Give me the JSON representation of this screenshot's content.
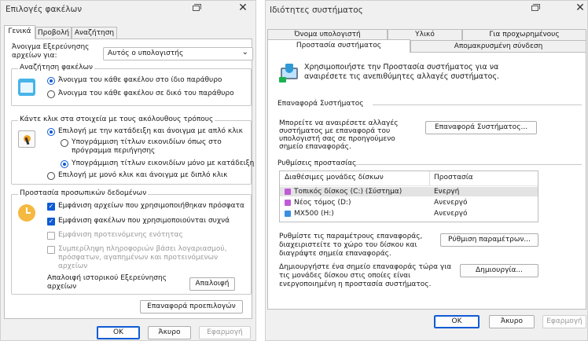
{
  "left": {
    "title": "Επιλογές φακέλων",
    "tabs": [
      "Γενικά",
      "Προβολή",
      "Αναζήτηση"
    ],
    "open_label_line1": "Άνοιγμα Εξερεύνησης",
    "open_label_line2": "αρχείων για:",
    "open_value": "Αυτός ο υπολογιστής",
    "browse": {
      "title": "Αναζήτηση φακέλων",
      "opt1": "Άνοιγμα του κάθε φακέλου στο ίδιο παράθυρο",
      "opt2": "Άνοιγμα του κάθε φακέλου σε δικό του παράθυρο"
    },
    "click": {
      "title": "Κάντε κλικ στα στοιχεία με τους ακόλουθους τρόπους",
      "opt1": "Επιλογή με την κατάδειξη και άνοιγμα με απλό κλικ",
      "sub1_line1": "Υπογράμμιση τίτλων εικονιδίων όπως στο",
      "sub1_line2": "πρόγραμμα περιήγησης",
      "sub2": "Υπογράμμιση τίτλων εικονιδίων μόνο με κατάδειξη",
      "opt2": "Επιλογή με μονό κλικ και άνοιγμα με διπλό κλικ"
    },
    "privacy": {
      "title": "Προστασία προσωπικών δεδομένων",
      "chk1": "Εμφάνιση αρχείων που χρησιμοποιήθηκαν πρόσφατα",
      "chk2": "Εμφάνιση φακέλων που χρησιμοποιούνται συχνά",
      "chk3": "Εμφάνιση προτεινόμενης ενότητας",
      "chk4_line1": "Συμπερίληψη πληροφοριών βάσει λογαριασμού,",
      "chk4_line2": "πρόσφατων, αγαπημένων και προτεινόμενων",
      "chk4_line3": "αρχείων",
      "clear_line1": "Απαλοιφή ιστορικού Εξερεύνησης",
      "clear_line2": "αρχείων",
      "clear_btn": "Απαλοιφή"
    },
    "restore_btn": "Επαναφορά προεπιλογών",
    "ok": "OK",
    "cancel": "Άκυρο",
    "apply": "Εφαρμογή"
  },
  "right": {
    "title": "Ιδιότητες συστήματος",
    "tabs_row1": [
      "Όνομα υπολογιστή",
      "Υλικό",
      "Για προχωρημένους"
    ],
    "tabs_row2": [
      "Προστασία συστήματος",
      "Απομακρυσμένη σύνδεση"
    ],
    "intro_line1": "Χρησιμοποιήστε την Προστασία συστήματος για να",
    "intro_line2": "αναιρέσετε τις ανεπιθύμητες αλλαγές συστήματος.",
    "restore_title": "Επαναφορά Συστήματος",
    "restore_line1": "Μπορείτε να αναιρέσετε αλλαγές",
    "restore_line2": "συστήματος με επαναφορά του",
    "restore_line3": "υπολογιστή σας σε προηγούμενο",
    "restore_line4": "σημείο επαναφοράς.",
    "restore_btn": "Επαναφορά Συστήματος...",
    "settings_title": "Ρυθμίσεις προστασίας",
    "col_drives": "Διαθέσιμες μονάδες δίσκων",
    "col_protection": "Προστασία",
    "drives": [
      {
        "name": "Τοπικός δίσκος (C:) (Σύστημα)",
        "status": "Ενεργή"
      },
      {
        "name": "Νέος τόμος (D:)",
        "status": "Ανενεργό"
      },
      {
        "name": "MX500 (H:)",
        "status": "Ανενεργό"
      }
    ],
    "config_line1": "Ρυθμίστε τις παραμέτρους επαναφοράς,",
    "config_line2": "διαχειριστείτε το χώρο του δίσκου και",
    "config_line3": "διαγράψτε σημεία επαναφοράς.",
    "config_btn": "Ρύθμιση παραμέτρων...",
    "create_line1": "Δημιουργήστε ένα σημείο επαναφοράς τώρα για",
    "create_line2": "τις μονάδες δίσκου στις οποίες είναι",
    "create_line3": "ενεργοποιημένη η προστασία συστήματος.",
    "create_btn": "Δημιουργία...",
    "ok": "OK",
    "cancel": "Άκυρο",
    "apply": "Εφαρμογή"
  }
}
